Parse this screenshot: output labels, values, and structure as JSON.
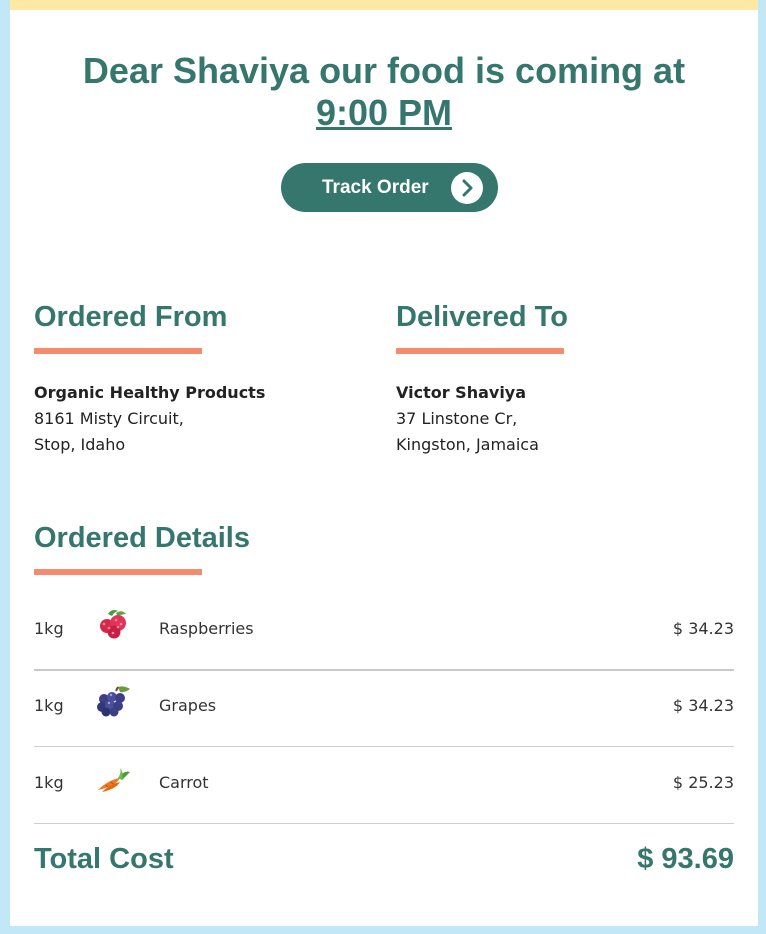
{
  "header": {
    "greeting": "Dear Shaviya our food is coming at",
    "time": "9:00 PM",
    "track_button_label": "Track Order",
    "track_icon": "chevron-right-icon"
  },
  "ordered_from": {
    "title": "Ordered From",
    "name": "Organic Healthy Products",
    "line1": "8161 Misty Circuit,",
    "line2": "Stop, Idaho"
  },
  "delivered_to": {
    "title": "Delivered To",
    "name": "Victor Shaviya",
    "line1": "37 Linstone Cr,",
    "line2": "Kingston, Jamaica"
  },
  "details": {
    "title": "Ordered Details",
    "items": [
      {
        "qty": "1kg",
        "icon": "raspberries-icon",
        "name": "Raspberries",
        "price": "$ 34.23"
      },
      {
        "qty": "1kg",
        "icon": "grapes-icon",
        "name": "Grapes",
        "price": "$ 34.23"
      },
      {
        "qty": "1kg",
        "icon": "carrot-icon",
        "name": "Carrot",
        "price": "$ 25.23"
      }
    ],
    "total_label": "Total Cost",
    "total_value": "$ 93.69"
  },
  "colors": {
    "brand": "#35766d",
    "accent": "#f58a6c",
    "top_bar": "#fde9a4",
    "page_bg": "#c2e8f7"
  }
}
